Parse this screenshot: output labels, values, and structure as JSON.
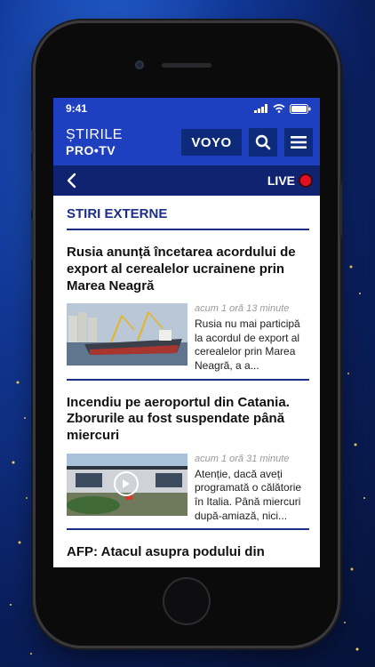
{
  "status_bar": {
    "time": "9:41"
  },
  "header": {
    "logo_top": "ȘTIRILE",
    "logo_bottom": "PRO•TV",
    "voyo_label": "VOYO",
    "search_icon": "search-icon",
    "menu_icon": "hamburger-menu-icon"
  },
  "subbar": {
    "back_icon": "chevron-left-icon",
    "live_label": "LIVE"
  },
  "section": {
    "title": "STIRI EXTERNE"
  },
  "articles": [
    {
      "title": "Rusia anunță încetarea acordului de export al cerealelor ucrainene prin Marea Neagră",
      "time": "acum 1 oră 13 minute",
      "description": "Rusia nu mai participă la acordul de export al cerealelor prin Marea Neagră, a a..."
    },
    {
      "title": "Incendiu pe aeroportul din Catania. Zborurile au fost suspendate până miercuri",
      "time": "acum 1 oră 31 minute",
      "description": "Atenție, dacă aveți programată o călătorie în Italia. Până miercuri după-amiază, nici..."
    },
    {
      "title": "AFP: Atacul asupra podului din"
    }
  ],
  "colors": {
    "brand_blue": "#1e3fbf",
    "navy": "#0f2370",
    "live_red": "#e0101e"
  }
}
